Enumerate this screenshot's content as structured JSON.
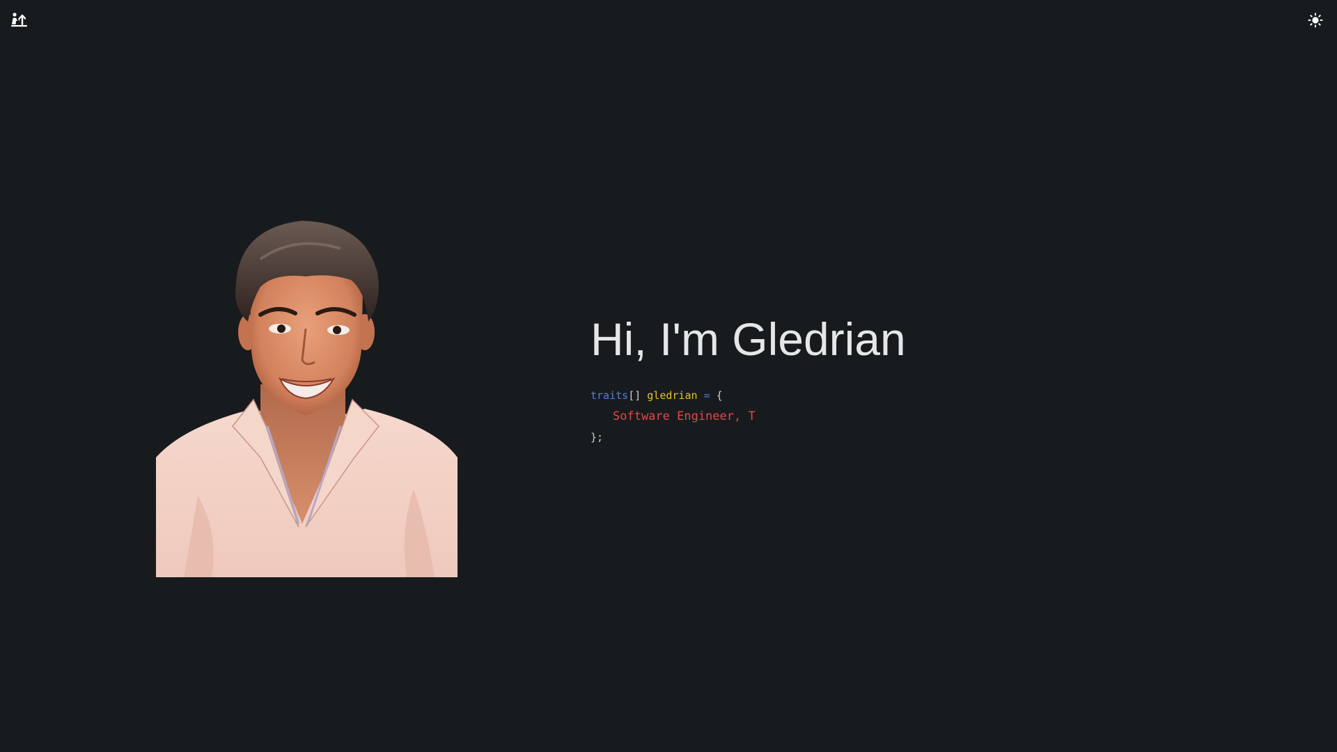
{
  "nav": {
    "logo_icon": "person-with-upload-arrow-icon",
    "theme_toggle_icon": "sun-icon"
  },
  "hero": {
    "title": "Hi, I'm Gledrian",
    "code": {
      "type_keyword": "traits",
      "brackets": "[]",
      "variable": "gledrian",
      "operator": "=",
      "open_brace": "{",
      "value": "Software Engineer, T",
      "close": "};"
    }
  },
  "portrait": {
    "alt": "Illustrated portrait"
  },
  "colors": {
    "background": "#181b1e",
    "keyword": "#4f7fd9",
    "variable": "#e6c229",
    "string": "#e2484b",
    "title": "#e4e6e8"
  }
}
